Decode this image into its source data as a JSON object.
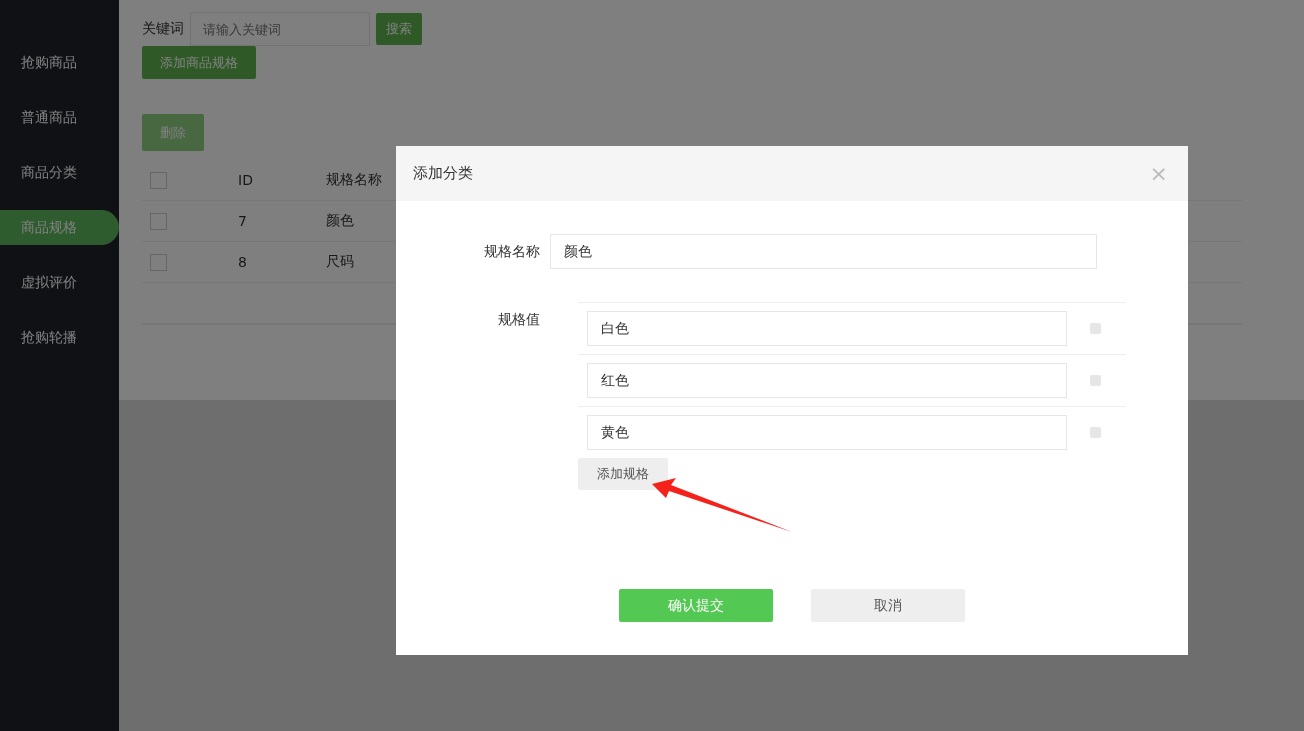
{
  "sidebar": {
    "items": [
      {
        "label": "抢购商品",
        "selected": false
      },
      {
        "label": "普通商品",
        "selected": false
      },
      {
        "label": "商品分类",
        "selected": false
      },
      {
        "label": "商品规格",
        "selected": true
      },
      {
        "label": "虚拟评价",
        "selected": false
      },
      {
        "label": "抢购轮播",
        "selected": false
      }
    ]
  },
  "search": {
    "label": "关键词",
    "placeholder": "请输入关键词",
    "button": "搜索"
  },
  "add_button": "添加商品规格",
  "delete_button": {
    "label": "删除",
    "disabled": true
  },
  "table": {
    "header_checked": false,
    "columns": [
      "ID",
      "规格名称"
    ],
    "rows": [
      {
        "checked": false,
        "cells": [
          "7",
          "颜色"
        ]
      },
      {
        "checked": false,
        "cells": [
          "8",
          "尺码"
        ]
      }
    ]
  },
  "dialog": {
    "title": "添加分类",
    "close": "×",
    "name_label": "规格名称",
    "name_value": "颜色",
    "values_label": "规格值",
    "values": [
      {
        "value": "白色",
        "checked": false
      },
      {
        "value": "红色",
        "checked": false
      },
      {
        "value": "黄色",
        "checked": false
      }
    ],
    "add_value_button": "添加规格",
    "submit": "确认提交",
    "cancel": "取消"
  }
}
